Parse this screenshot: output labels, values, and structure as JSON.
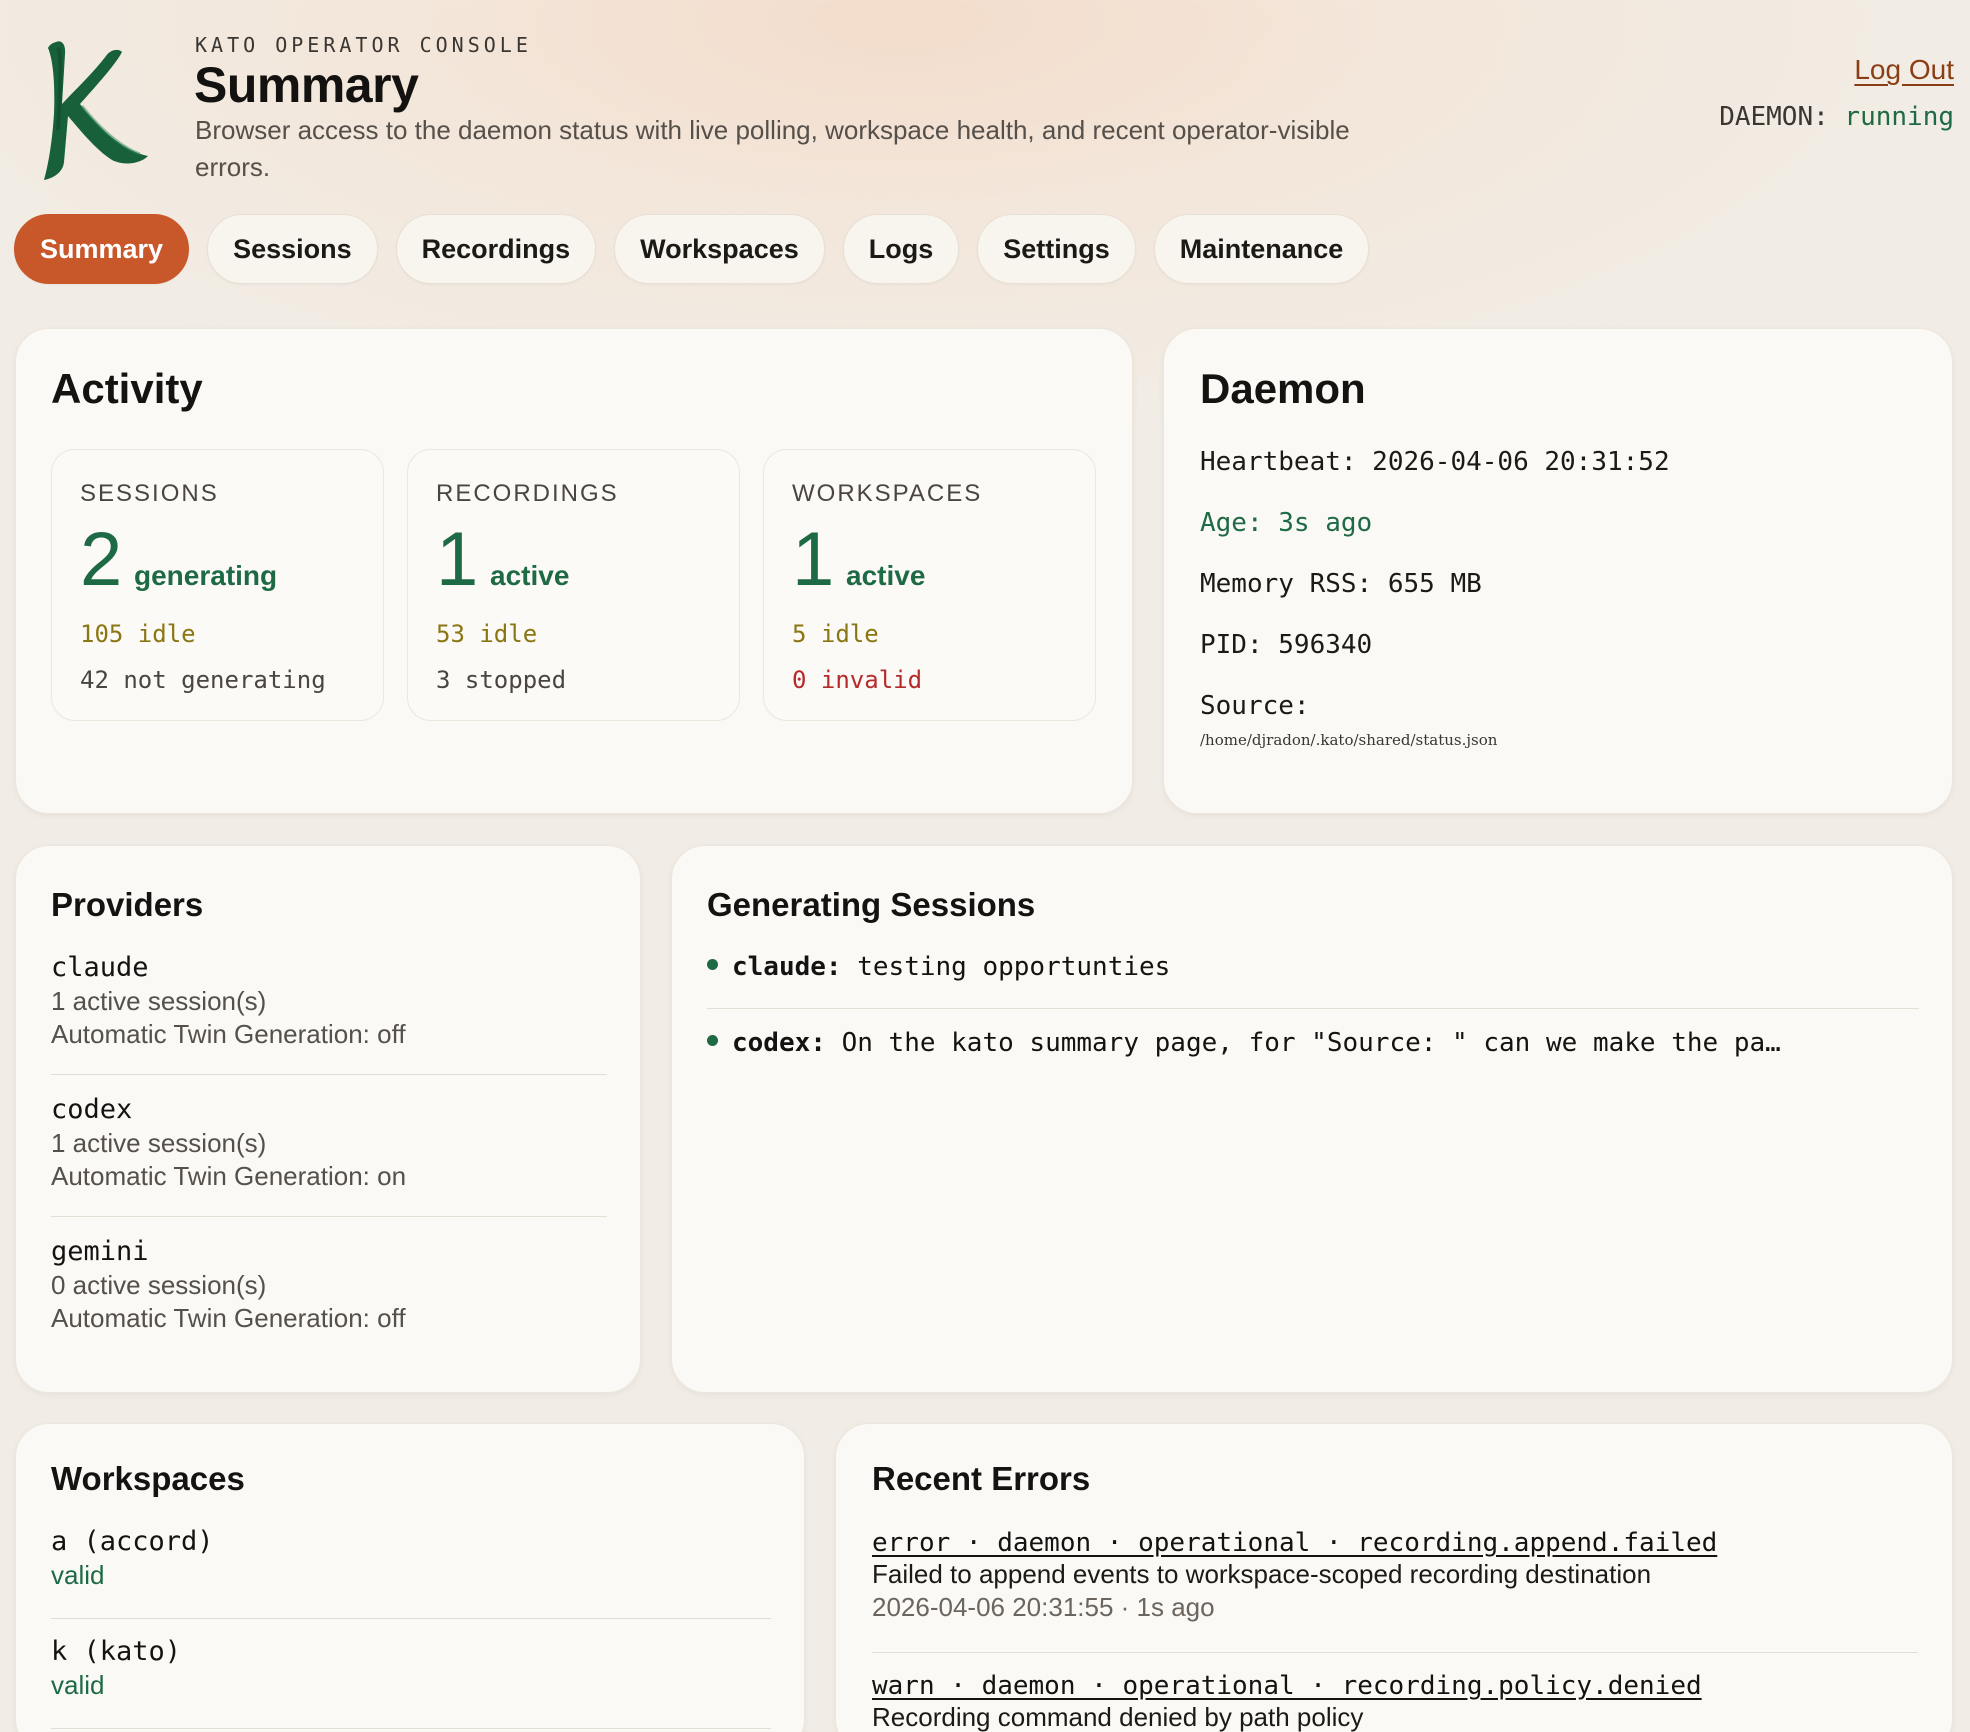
{
  "header": {
    "eyebrow": "KATO OPERATOR CONSOLE",
    "title": "Summary",
    "subtitle": "Browser access to the daemon status with live polling, workspace health, and recent operator-visible errors.",
    "logout_label": "Log Out",
    "daemon_label": "DAEMON:",
    "daemon_value": "running"
  },
  "tabs": [
    "Summary",
    "Sessions",
    "Recordings",
    "Workspaces",
    "Logs",
    "Settings",
    "Maintenance"
  ],
  "active_tab": "Summary",
  "activity": {
    "title": "Activity",
    "stats": [
      {
        "label": "SESSIONS",
        "value": "2",
        "value_suffix": "generating",
        "line1": "105 idle",
        "line2": "42 not generating"
      },
      {
        "label": "RECORDINGS",
        "value": "1",
        "value_suffix": "active",
        "line1": "53 idle",
        "line2": "3 stopped"
      },
      {
        "label": "WORKSPACES",
        "value": "1",
        "value_suffix": "active",
        "line1": "5 idle",
        "line2": "0 invalid"
      }
    ]
  },
  "daemon": {
    "title": "Daemon",
    "heartbeat": "Heartbeat: 2026-04-06 20:31:52",
    "age": "Age: 3s ago",
    "memory": "Memory RSS: 655 MB",
    "pid": "PID: 596340",
    "source_label": "Source:",
    "source_path": "/home/djradon/.kato/shared/status.json"
  },
  "providers": {
    "title": "Providers",
    "items": [
      {
        "name": "claude",
        "sessions": "1 active session(s)",
        "twin": "Automatic Twin Generation: off"
      },
      {
        "name": "codex",
        "sessions": "1 active session(s)",
        "twin": "Automatic Twin Generation: on"
      },
      {
        "name": "gemini",
        "sessions": "0 active session(s)",
        "twin": "Automatic Twin Generation: off"
      }
    ]
  },
  "generating_sessions": {
    "title": "Generating Sessions",
    "items": [
      {
        "provider": "claude:",
        "text": "testing opportunties"
      },
      {
        "provider": "codex:",
        "text": "On the kato summary page, for \"Source: \" can we make the pa…"
      }
    ]
  },
  "workspaces": {
    "title": "Workspaces",
    "items": [
      {
        "name": "a (accord)",
        "status": "valid"
      },
      {
        "name": "k (kato)",
        "status": "valid"
      }
    ]
  },
  "recent_errors": {
    "title": "Recent Errors",
    "items": [
      {
        "head": "error · daemon · operational · recording.append.failed",
        "message": "Failed to append events to workspace-scoped recording destination",
        "time": "2026-04-06 20:31:55 · 1s ago"
      },
      {
        "head": "warn · daemon · operational · recording.policy.denied",
        "message": "Recording command denied by path policy",
        "time": ""
      }
    ]
  },
  "colors": {
    "accent": "#c8582a",
    "green": "#1e6a44",
    "amber": "#8a7613",
    "red": "#b52a2a",
    "link": "#8b3e15"
  }
}
